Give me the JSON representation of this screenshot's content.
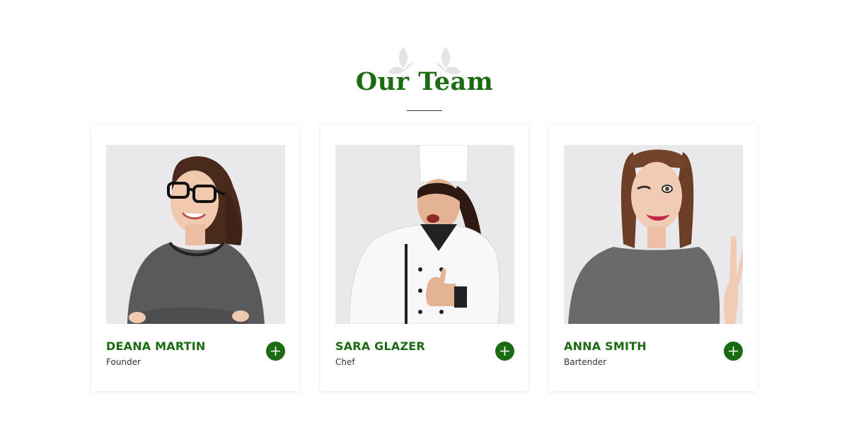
{
  "section": {
    "title": "Our Team",
    "colors": {
      "accent": "#1b6b12",
      "divider": "#333333",
      "photo_bg": "#e8e8ea",
      "ornament": "#e2e2e2"
    }
  },
  "team": [
    {
      "name": "DEANA MARTIN",
      "role": "Founder",
      "photo": "woman-with-glasses-photo",
      "action_icon": "plus-icon"
    },
    {
      "name": "SARA GLAZER",
      "role": "Chef",
      "photo": "chef-thumbs-up-photo",
      "action_icon": "plus-icon"
    },
    {
      "name": "ANNA SMITH",
      "role": "Bartender",
      "photo": "woman-winking-photo",
      "action_icon": "plus-icon"
    }
  ]
}
